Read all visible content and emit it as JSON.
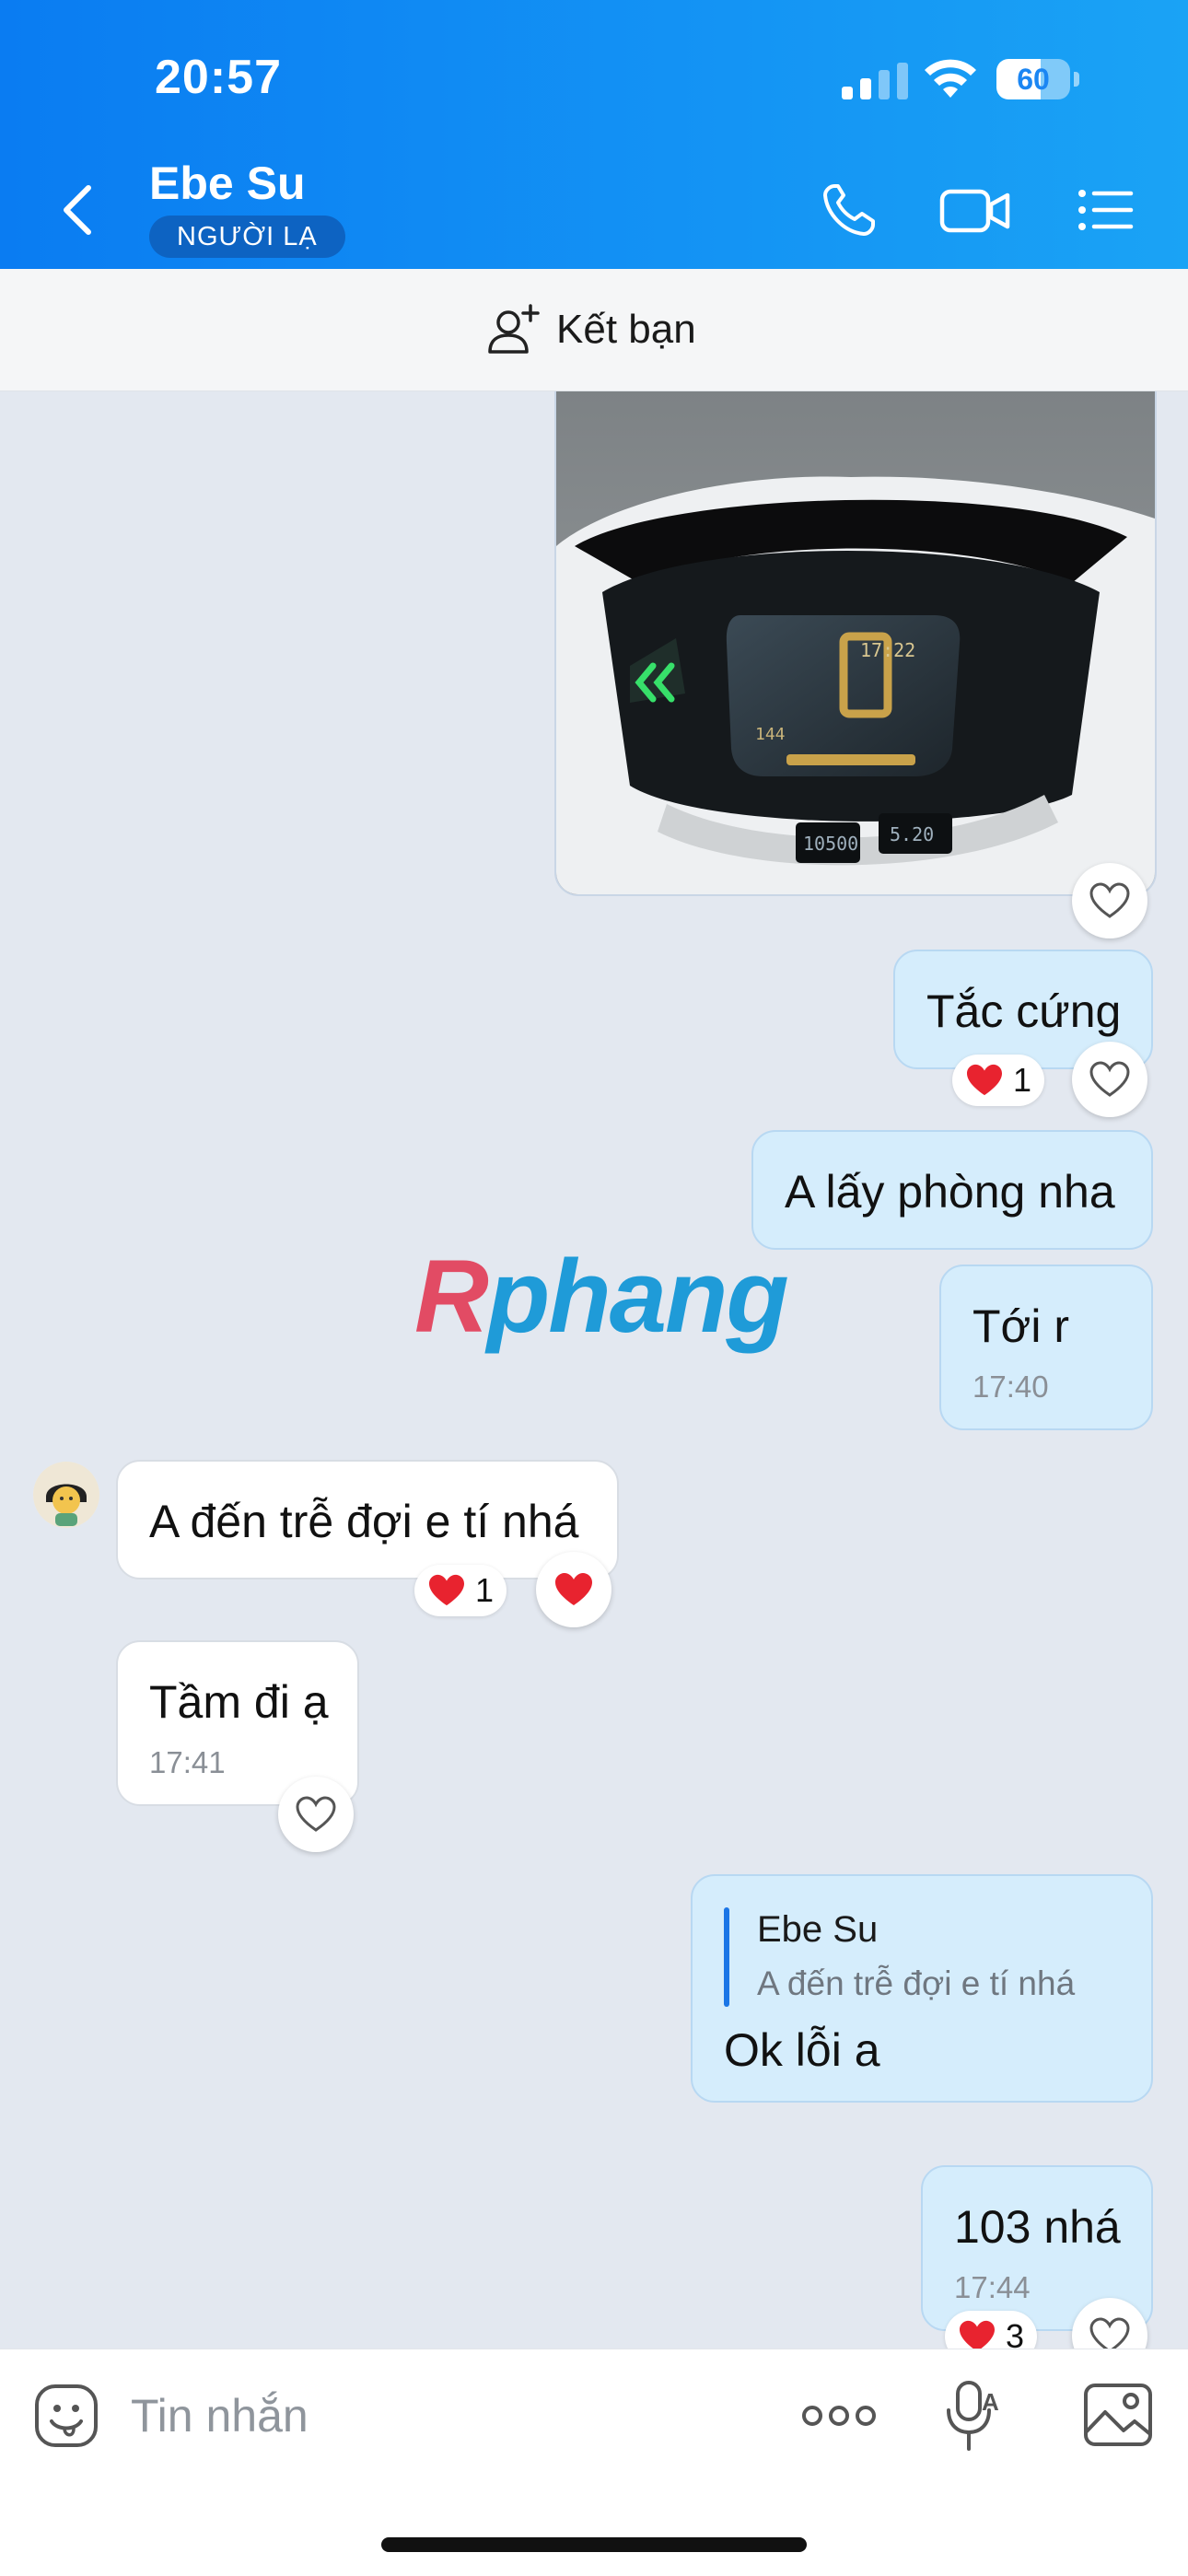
{
  "status_bar": {
    "time": "20:57",
    "battery": "60",
    "battery_level": 0.6
  },
  "header": {
    "contact_name": "Ebe Su",
    "badge": "NGƯỜI LẠ"
  },
  "add_friend": {
    "label": "Kết bạn"
  },
  "messages": [
    {
      "side": "me",
      "type": "image",
      "description": "motorcycle dashboard photo"
    },
    {
      "side": "me",
      "text": "Tắc cứng",
      "reaction": {
        "emoji": "heart",
        "count": "1"
      }
    },
    {
      "side": "me",
      "text": "A lấy phòng nha"
    },
    {
      "side": "me",
      "text": "Tới r",
      "time": "17:40"
    },
    {
      "side": "them",
      "text": "A đến trễ đợi e tí nhá",
      "reaction": {
        "emoji": "heart",
        "count": "1"
      }
    },
    {
      "side": "them",
      "text": "Tầm đi ạ",
      "time": "17:41"
    },
    {
      "side": "me",
      "reply_to": {
        "name": "Ebe Su",
        "text": "A đến trễ đợi e tí nhá"
      },
      "text": "Ok lỗi a"
    },
    {
      "side": "me",
      "text": "103 nhá",
      "time": "17:44",
      "reaction": {
        "emoji": "heart",
        "count": "3"
      }
    }
  ],
  "watermark": {
    "first": "R",
    "rest": "phang"
  },
  "composer": {
    "placeholder": "Tin nhắn"
  },
  "colors": {
    "header_start": "#0a7cf2",
    "header_end": "#1aa3f5",
    "my_bubble": "#d5edfc",
    "their_bubble": "#ffffff",
    "heart": "#e8232f"
  }
}
